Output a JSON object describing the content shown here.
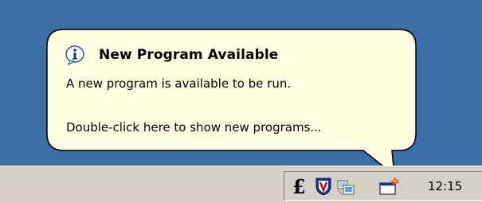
{
  "balloon": {
    "title": "New Program Available",
    "line1": "A new program is available to be run.",
    "line2": "Double-click here to show new programs...",
    "icon": "info-icon",
    "background": "#ffffe1"
  },
  "desktop": {
    "background": "#3a6ea5"
  },
  "taskbar": {
    "background": "#d4d0c8",
    "tray_icons": [
      "currency-pound-icon",
      "antivirus-shield-icon",
      "network-computer-icon",
      "new-program-icon"
    ],
    "clock": "12:15"
  }
}
